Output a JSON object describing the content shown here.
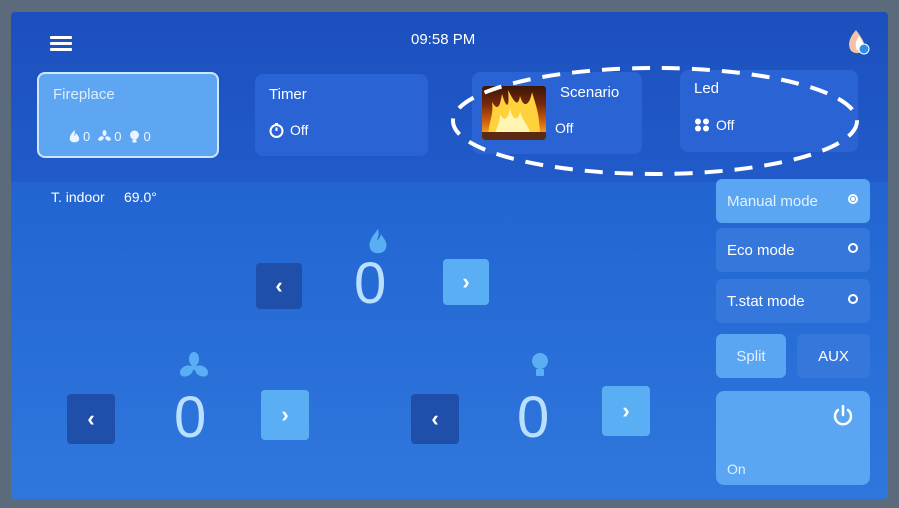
{
  "header": {
    "time": "09:58 PM"
  },
  "cards": {
    "fireplace": {
      "title": "Fireplace",
      "flame_value": "0",
      "fan_value": "0",
      "light_value": "0"
    },
    "timer": {
      "title": "Timer",
      "status": "Off"
    },
    "scenario": {
      "title": "Scenario",
      "status": "Off"
    },
    "led": {
      "title": "Led",
      "status": "Off"
    }
  },
  "indoor": {
    "label": "T. indoor",
    "value": "69.0°"
  },
  "controls": {
    "flame": {
      "value": "0",
      "dec_label": "‹",
      "inc_label": "›"
    },
    "fan": {
      "value": "0",
      "dec_label": "‹",
      "inc_label": "›"
    },
    "light": {
      "value": "0",
      "dec_label": "‹",
      "inc_label": "›"
    }
  },
  "modes": [
    {
      "label": "Manual mode",
      "selected": true
    },
    {
      "label": "Eco mode",
      "selected": false
    },
    {
      "label": "T.stat mode",
      "selected": false
    }
  ],
  "buttons": {
    "split": "Split",
    "aux": "AUX",
    "power_label": "On"
  },
  "colors": {
    "background": "#215bc9",
    "card": "#2a63d3",
    "active": "#5fa6f2",
    "dark_button": "#1f4fa8"
  },
  "icons": [
    "menu-icon",
    "brand-icon",
    "flame-icon",
    "fan-icon",
    "bulb-icon",
    "timer-icon",
    "led-icon",
    "power-icon"
  ]
}
